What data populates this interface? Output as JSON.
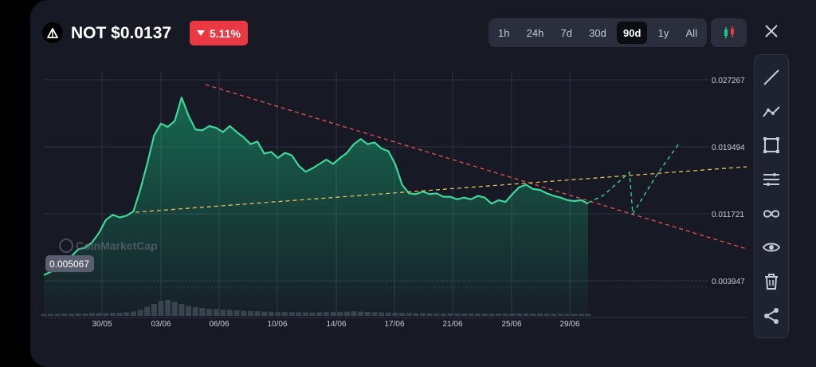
{
  "header": {
    "title": "NOT $0.0137",
    "change": "5.11%",
    "change_color": "#ea3943"
  },
  "range_tabs": [
    {
      "label": "1h",
      "active": false
    },
    {
      "label": "24h",
      "active": false
    },
    {
      "label": "7d",
      "active": false
    },
    {
      "label": "30d",
      "active": false
    },
    {
      "label": "90d",
      "active": true
    },
    {
      "label": "1y",
      "active": false
    },
    {
      "label": "All",
      "active": false
    }
  ],
  "toolbar": [
    "line-tool-icon",
    "polyline-tool-icon",
    "rectangle-tool-icon",
    "parallel-lines-tool-icon",
    "infinity-tool-icon",
    "eye-icon",
    "trash-icon",
    "share-icon"
  ],
  "colors": {
    "line": "#3fd69a",
    "fill": "#16c784",
    "trend_red": "#e55353",
    "trend_yellow": "#e0c060",
    "projection": "#3fd69a"
  },
  "watermark": "CoinMarketCap",
  "chart_data": {
    "type": "area",
    "title": "",
    "xlabel": "",
    "ylabel": "",
    "x_ticks": [
      "30/05",
      "03/06",
      "06/06",
      "10/06",
      "14/06",
      "17/06",
      "21/06",
      "25/06",
      "29/06"
    ],
    "y_ticks": [
      0.027267,
      0.019494,
      0.011721,
      0.003947
    ],
    "y_tick_labels": [
      "0.027267",
      "0.019494",
      "0.011721",
      "0.003947"
    ],
    "ylim": [
      0.0038,
      0.0285
    ],
    "current_low_label": "0.005067",
    "series": [
      {
        "values": [
          0.0046,
          0.005,
          0.0054,
          0.0061,
          0.0068,
          0.0076,
          0.0078,
          0.0084,
          0.0095,
          0.011,
          0.0116,
          0.0113,
          0.0115,
          0.012,
          0.0145,
          0.0175,
          0.0208,
          0.0222,
          0.0218,
          0.0225,
          0.0252,
          0.0231,
          0.0215,
          0.0214,
          0.0219,
          0.0217,
          0.0212,
          0.0219,
          0.0212,
          0.0206,
          0.0198,
          0.0201,
          0.0187,
          0.0189,
          0.0182,
          0.0188,
          0.0185,
          0.0173,
          0.0166,
          0.017,
          0.0175,
          0.018,
          0.0175,
          0.0182,
          0.0188,
          0.0198,
          0.0204,
          0.0198,
          0.02,
          0.0193,
          0.019,
          0.0175,
          0.0151,
          0.0141,
          0.014,
          0.0143,
          0.014,
          0.0141,
          0.0137,
          0.0137,
          0.0134,
          0.0136,
          0.0134,
          0.0138,
          0.0136,
          0.0129,
          0.0133,
          0.0131,
          0.014,
          0.0148,
          0.0151,
          0.0146,
          0.0145,
          0.0141,
          0.0138,
          0.0136,
          0.0133,
          0.0132,
          0.0133,
          0.0129
        ]
      }
    ],
    "volume": [
      1,
      1,
      1,
      1.2,
      1.1,
      1.3,
      1.2,
      1.4,
      1.5,
      1.4,
      1.6,
      1.5,
      1.8,
      2.2,
      3,
      4.5,
      6,
      7.5,
      8,
      7,
      6,
      5,
      4.5,
      4,
      3.5,
      3.4,
      3.2,
      3,
      2.8,
      2.6,
      2.5,
      2.4,
      2.2,
      2.1,
      2,
      2,
      1.9,
      1.8,
      1.8,
      1.7,
      1.8,
      1.9,
      2,
      2.1,
      2.2,
      2.3,
      2.2,
      2,
      1.9,
      1.8,
      1.7,
      1.6,
      1.5,
      1.5,
      1.4,
      1.4,
      1.3,
      1.3,
      1.2,
      1.3,
      1.2,
      1.2,
      1.2,
      1.3,
      1.2,
      1.1,
      1.2,
      1.1,
      1.2,
      1.3,
      1.3,
      1.2,
      1.2,
      1.1,
      1.1,
      1.1,
      1,
      1,
      1,
      1
    ],
    "trendlines": [
      {
        "style": "red-dashed",
        "from": [
          0,
          0.0275
        ],
        "to": [
          1,
          0.008
        ]
      },
      {
        "style": "yellow-dashed",
        "from": [
          0,
          0.0116
        ],
        "to": [
          1,
          0.0177
        ]
      }
    ],
    "projection": [
      [
        0.0129
      ],
      [
        0.0149
      ],
      [
        0.0163
      ],
      [
        0.0118
      ],
      [
        0.0165
      ],
      [
        0.0195
      ]
    ]
  }
}
